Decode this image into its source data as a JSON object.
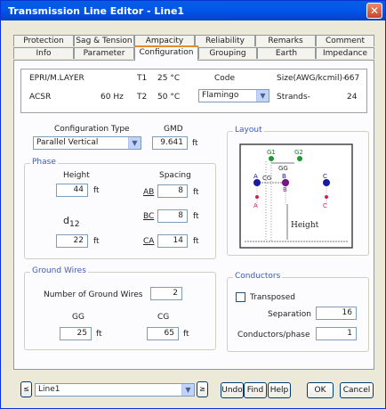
{
  "window": {
    "title": "Transmission Line Editor - Line1",
    "close_glyph": "✕"
  },
  "tabs_row1": [
    "Protection",
    "Sag & Tension",
    "Ampacity",
    "Reliability",
    "Remarks",
    "Comment"
  ],
  "tabs_row2": [
    "Info",
    "Parameter",
    "Configuration",
    "Grouping",
    "Earth",
    "Impedance"
  ],
  "active_tab": "Configuration",
  "info": {
    "layer": "EPRI/M.LAYER",
    "t1_label": "T1",
    "t1_value": "25 °C",
    "code_label": "Code",
    "size_label": "Size(AWG/kcmil)-",
    "size_value": "667",
    "conductor_type": "ACSR",
    "freq": "60 Hz",
    "t2_label": "T2",
    "t2_value": "50 °C",
    "code_value": "Flamingo",
    "strands_label": "Strands-",
    "strands_value": "24"
  },
  "config": {
    "type_label": "Configuration Type",
    "type_value": "Parallel Vertical",
    "gmd_label": "GMD",
    "gmd_value": "9.641",
    "gmd_unit": "ft"
  },
  "phase": {
    "legend": "Phase",
    "height_label": "Height",
    "height_value": "44",
    "height_unit": "ft",
    "d12_label": "d",
    "d12_sub": "12",
    "d12_value": "22",
    "d12_unit": "ft",
    "spacing_label": "Spacing",
    "ab_label": "AB",
    "ab_value": "8",
    "ab_unit": "ft",
    "bc_label": "BC",
    "bc_value": "8",
    "bc_unit": "ft",
    "ca_label": "CA",
    "ca_value": "14",
    "ca_unit": "ft"
  },
  "layout": {
    "legend": "Layout",
    "labels": {
      "g1": "G1",
      "g2": "G2",
      "gg": "GG",
      "cg": "CG",
      "a": "A",
      "b": "B",
      "c": "C",
      "a2": "A",
      "b2": "B",
      "c2": "C",
      "height": "Height"
    }
  },
  "ground_wires": {
    "legend": "Ground Wires",
    "count_label": "Number of Ground Wires",
    "count_value": "2",
    "gg_label": "GG",
    "gg_value": "25",
    "gg_unit": "ft",
    "cg_label": "CG",
    "cg_value": "65",
    "cg_unit": "ft"
  },
  "conductors": {
    "legend": "Conductors",
    "transposed_label": "Transposed",
    "separation_label": "Separation",
    "separation_value": "16",
    "per_phase_label": "Conductors/phase",
    "per_phase_value": "1"
  },
  "footer": {
    "prev_glyph": "≤",
    "line_value": "Line1",
    "next_glyph": "≥",
    "undo": "Undo",
    "find": "Find",
    "help": "Help",
    "ok": "OK",
    "cancel": "Cancel"
  }
}
